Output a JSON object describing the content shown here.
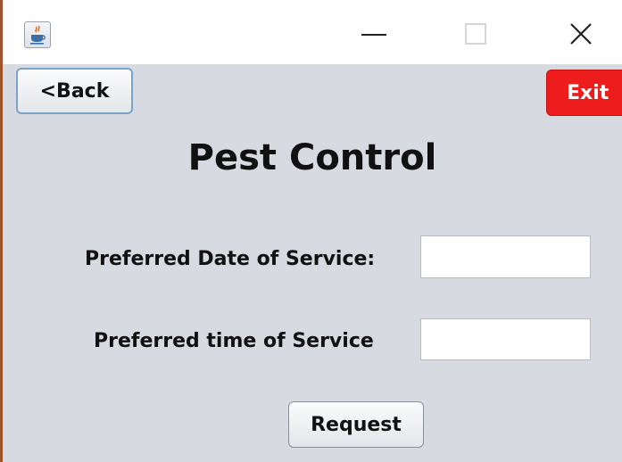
{
  "window": {
    "app_icon": "java-cup-icon",
    "controls": [
      "minimize-icon",
      "maximize-icon",
      "close-icon"
    ]
  },
  "toolbar": {
    "back_label": "<Back",
    "exit_label": "Exit"
  },
  "page": {
    "title": "Pest Control"
  },
  "form": {
    "date_label": "Preferred Date of Service:",
    "date_value": "",
    "time_label": "Preferred time of Service",
    "time_value": "",
    "submit_label": "Request"
  },
  "colors": {
    "exit_bg": "#ee1d1d",
    "content_bg": "#d7dae0"
  }
}
